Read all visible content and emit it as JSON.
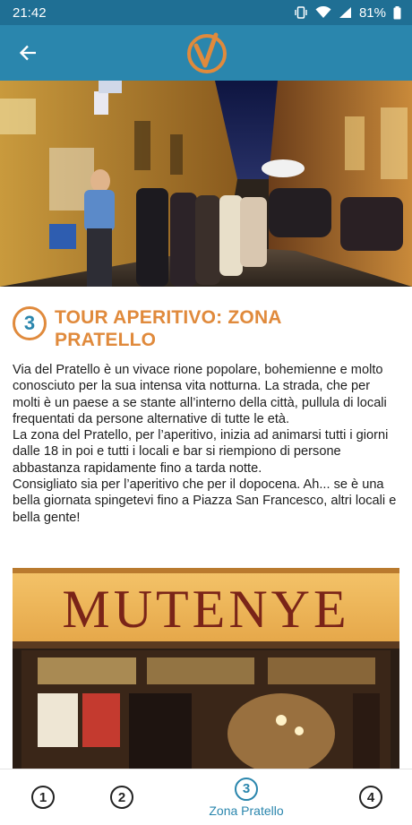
{
  "status": {
    "time": "21:42",
    "battery": "81%"
  },
  "appbar": {
    "back_icon": "arrow-left-icon",
    "logo_icon": "check-v-logo-icon"
  },
  "article": {
    "number": "3",
    "title": "TOUR APERITIVO: ZONA PRATELLO",
    "paragraphs": [
      "Via del Pratello è un vivace rione popolare, bohemienne e molto conosciuto per la sua intensa vita notturna. La strada, che per molti è un paese a se stante all’interno della città, pullula di locali frequentati da persone alternative di tutte le età.",
      "La zona del Pratello, per l’aperitivo, inizia ad animarsi tutti i giorni dalle 18 in poi e tutti i locali e bar si riempiono di persone abbastanza rapidamente fino a tarda notte.",
      "Consigliato sia per l’aperitivo che per il dopocena. Ah... se è una bella giornata spingetevi fino a Piazza San Francesco, altri locali e bella gente!"
    ],
    "photo2_sign": "MUTENYE"
  },
  "bottom_nav": {
    "items": [
      {
        "number": "1",
        "label": ""
      },
      {
        "number": "2",
        "label": ""
      },
      {
        "number": "3",
        "label": "Zona Pratello"
      },
      {
        "number": "4",
        "label": ""
      }
    ],
    "active_index": 2
  },
  "colors": {
    "appbar": "#2a86ad",
    "statusbar": "#1f6f94",
    "accent": "#e08a3c"
  }
}
